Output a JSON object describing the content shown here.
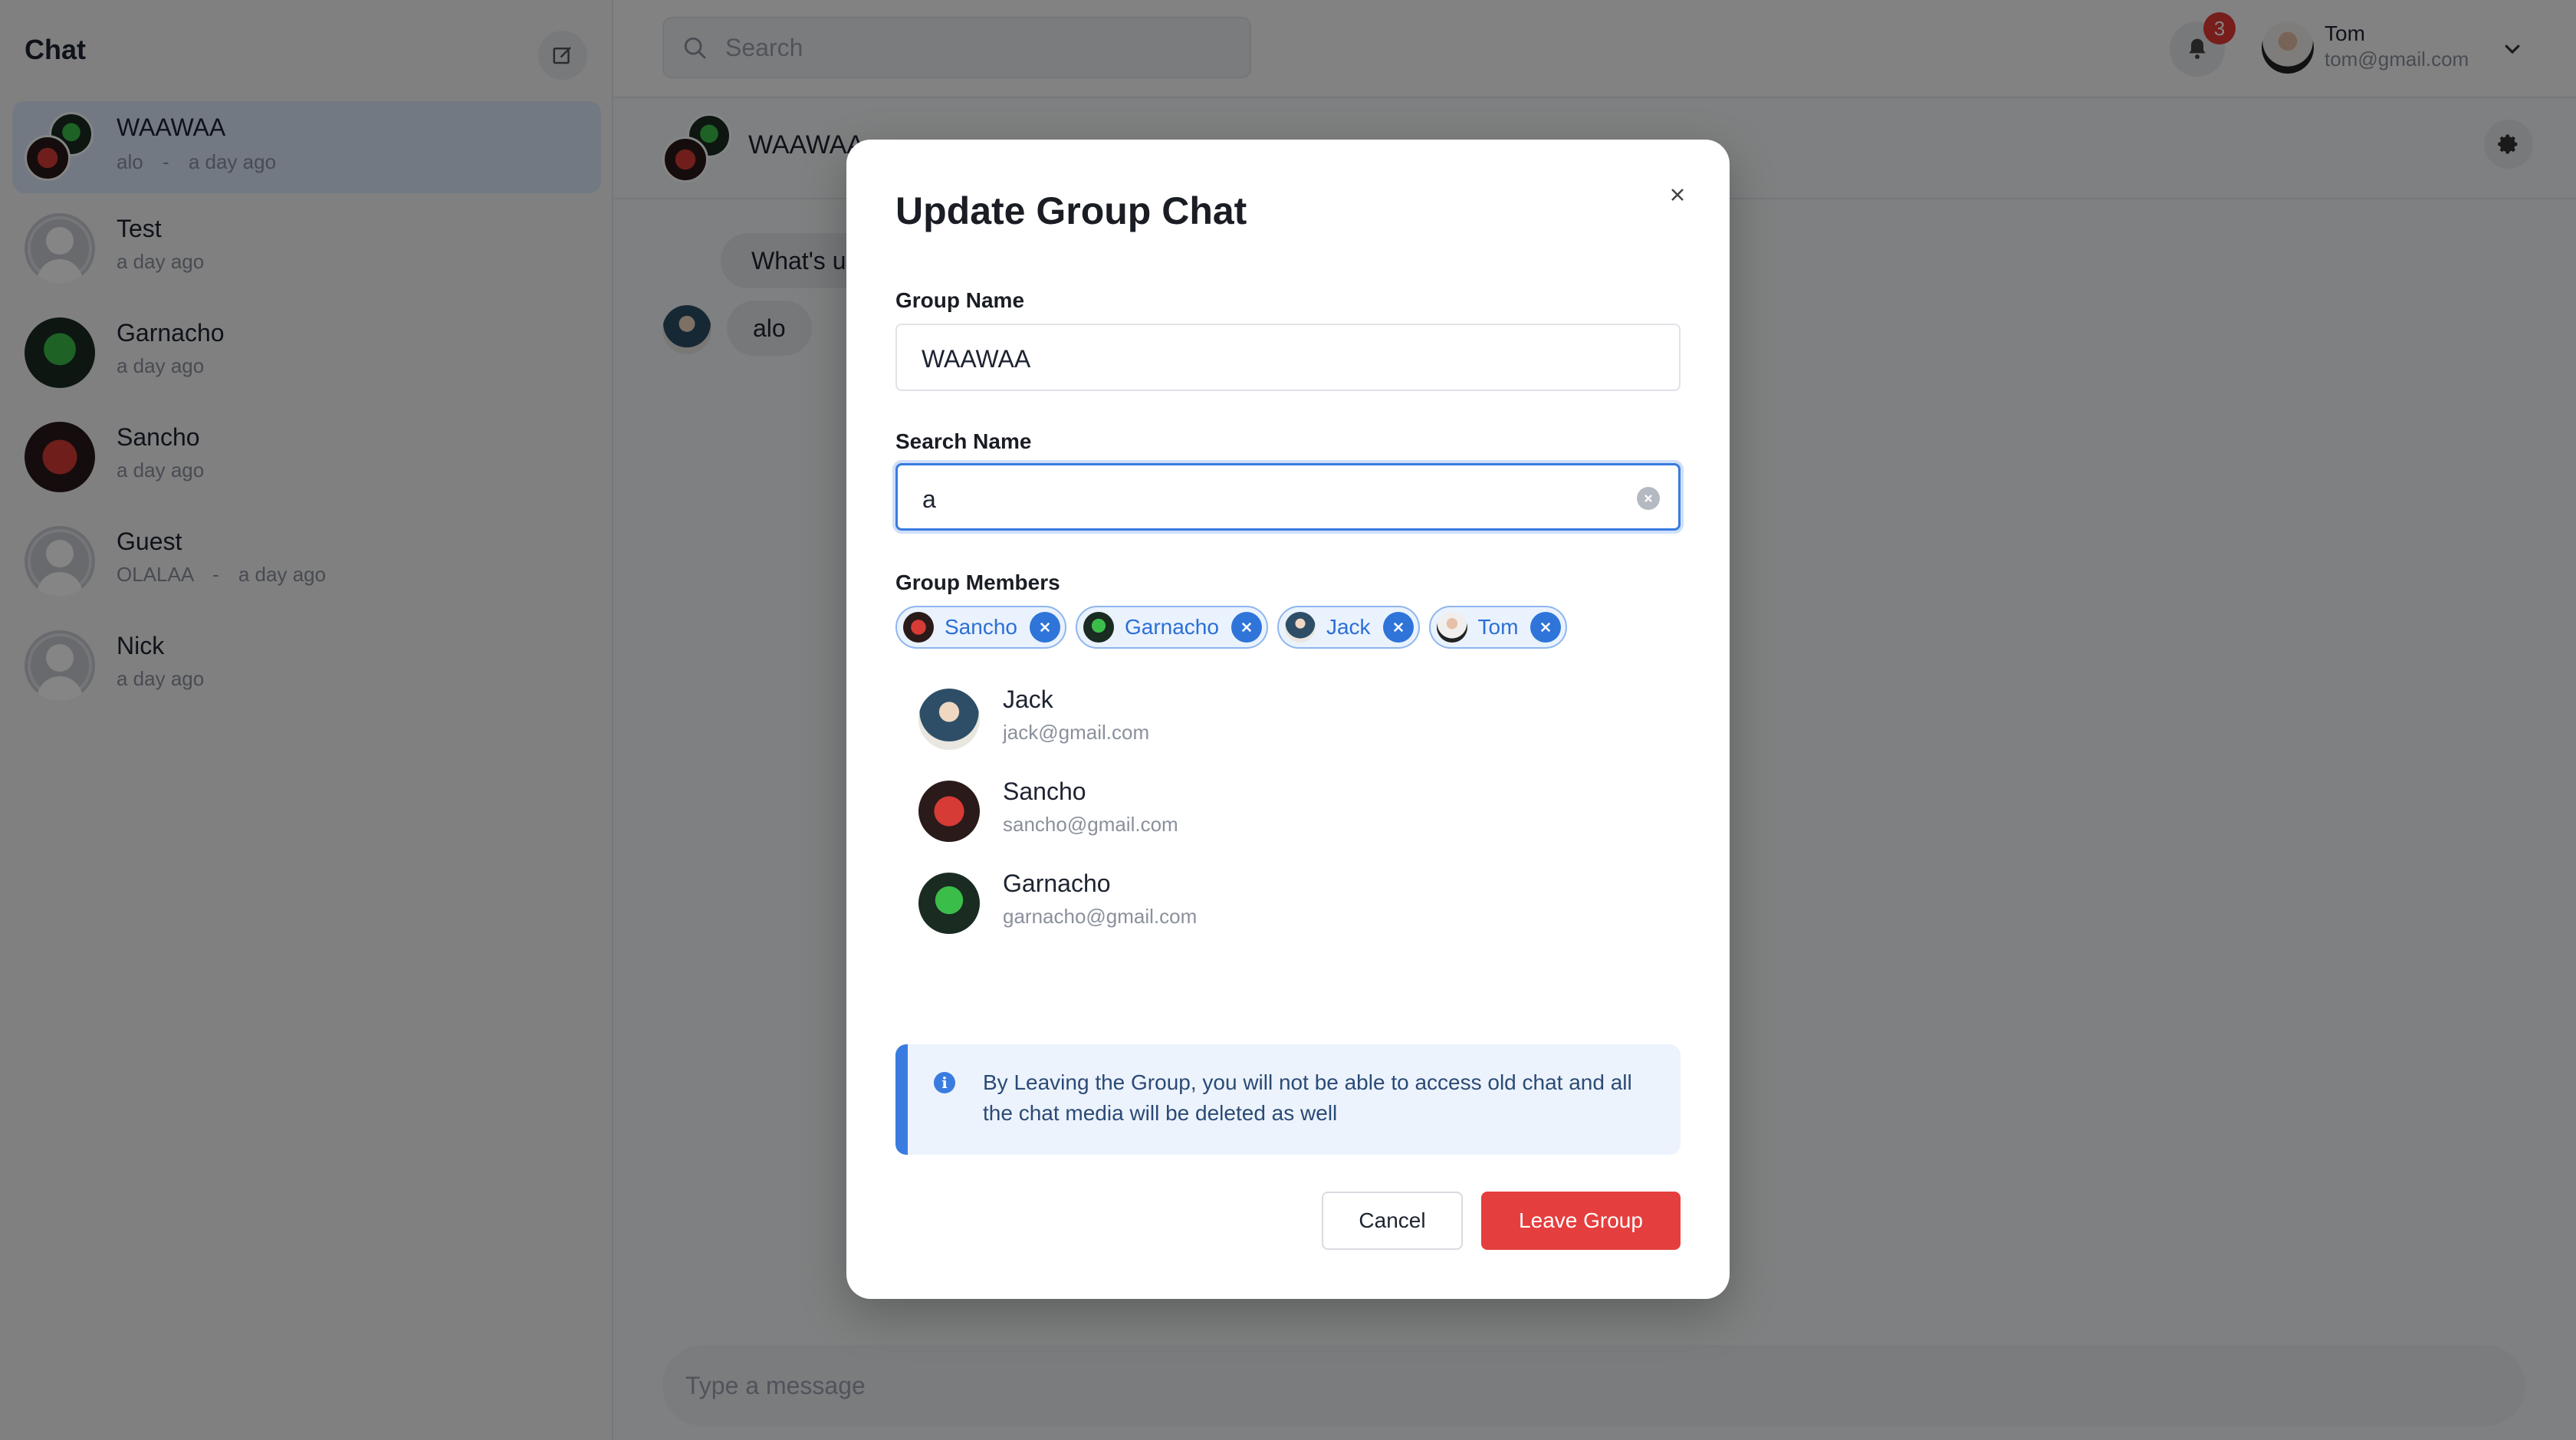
{
  "sidebar": {
    "title": "Chat",
    "chats": [
      {
        "name": "WAAWAA",
        "last_message": "alo",
        "separator": "-",
        "time": "a day ago"
      },
      {
        "name": "Test",
        "time": "a day ago"
      },
      {
        "name": "Garnacho",
        "time": "a day ago"
      },
      {
        "name": "Sancho",
        "time": "a day ago"
      },
      {
        "name": "Guest",
        "last_message": "OLALAA",
        "separator": "-",
        "time": "a day ago"
      },
      {
        "name": "Nick",
        "time": "a day ago"
      }
    ]
  },
  "topbar": {
    "search_placeholder": "Search",
    "notification_count": "3",
    "user": {
      "name": "Tom",
      "email": "tom@gmail.com"
    }
  },
  "conversation": {
    "title": "WAAWAA",
    "messages": [
      {
        "text": "What's up",
        "side": "right"
      },
      {
        "text": "alo",
        "side": "left"
      }
    ],
    "composer_placeholder": "Type a message"
  },
  "modal": {
    "title": "Update Group Chat",
    "group_name_label": "Group Name",
    "group_name_value": "WAAWAA",
    "search_name_label": "Search Name",
    "search_name_value": "a",
    "members_label": "Group Members",
    "members": [
      {
        "name": "Sancho"
      },
      {
        "name": "Garnacho"
      },
      {
        "name": "Jack"
      },
      {
        "name": "Tom"
      }
    ],
    "results": [
      {
        "name": "Jack",
        "email": "jack@gmail.com"
      },
      {
        "name": "Sancho",
        "email": "sancho@gmail.com"
      },
      {
        "name": "Garnacho",
        "email": "garnacho@gmail.com"
      }
    ],
    "alert_text": "By Leaving the Group, you will not be able to access old chat and all the chat media will be deleted as well",
    "cancel_label": "Cancel",
    "leave_label": "Leave Group"
  },
  "colors": {
    "accent": "#3a7be0",
    "danger": "#e53e3e",
    "badge": "#e53935"
  }
}
